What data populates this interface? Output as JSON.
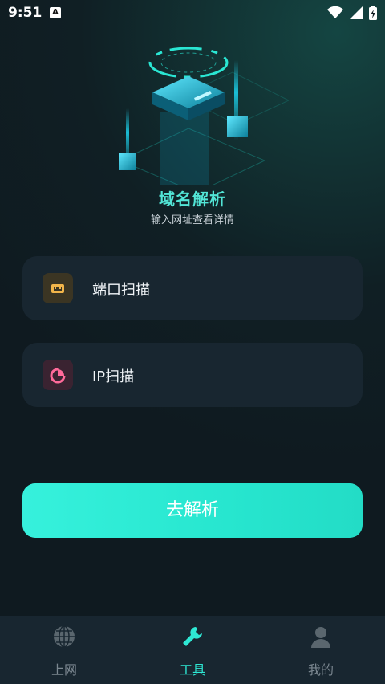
{
  "status_bar": {
    "time": "9:51",
    "badge": "A"
  },
  "header": {
    "title": "域名解析",
    "subtitle": "输入网址查看详情"
  },
  "tools": [
    {
      "label": "端口扫描",
      "icon": "router-port-icon",
      "color": "#f2b54a"
    },
    {
      "label": "IP扫描",
      "icon": "pie-scan-icon",
      "color": "#ff6a9a"
    }
  ],
  "action_button": {
    "label": "去解析"
  },
  "tabbar": {
    "items": [
      {
        "label": "上网",
        "icon": "globe-icon",
        "active": false
      },
      {
        "label": "工具",
        "icon": "wrench-icon",
        "active": true
      },
      {
        "label": "我的",
        "icon": "user-icon",
        "active": false
      }
    ]
  },
  "colors": {
    "accent": "#2ee8d4",
    "inactive": "#5a666e",
    "card": "#182630"
  }
}
